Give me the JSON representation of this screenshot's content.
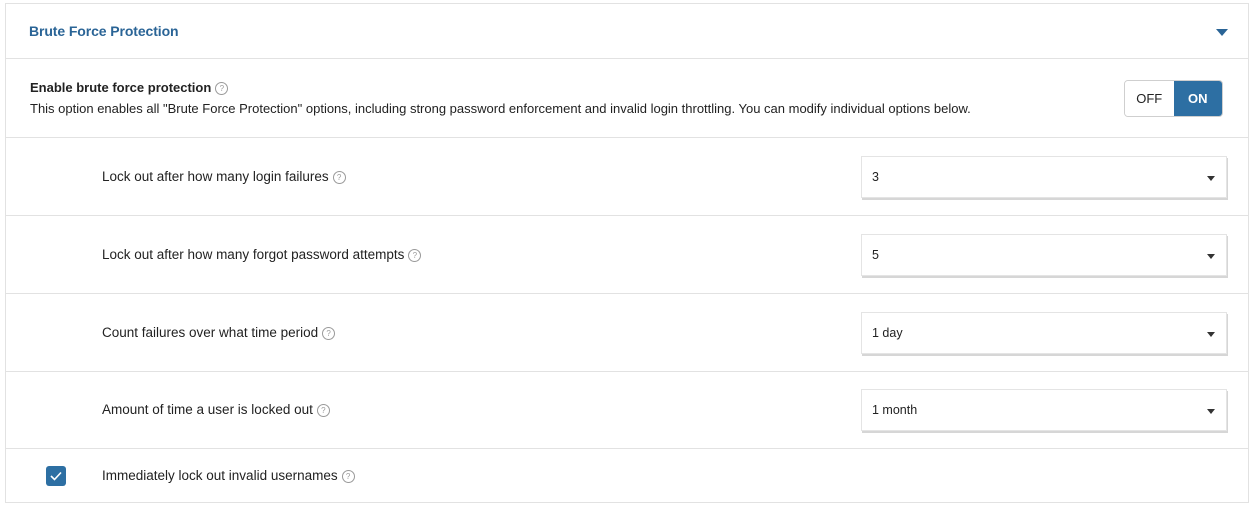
{
  "panel": {
    "title": "Brute Force Protection",
    "collapse_icon": "caret-down-icon"
  },
  "enable": {
    "title": "Enable brute force protection",
    "description": "This option enables all \"Brute Force Protection\" options, including strong password enforcement and invalid login throttling. You can modify individual options below.",
    "help_icon": "help-circle-icon",
    "toggle": {
      "off_label": "OFF",
      "on_label": "ON",
      "state": "ON"
    }
  },
  "settings": [
    {
      "label": "Lock out after how many login failures",
      "value": "3"
    },
    {
      "label": "Lock out after how many forgot password attempts",
      "value": "5"
    },
    {
      "label": "Count failures over what time period",
      "value": "1 day"
    },
    {
      "label": "Amount of time a user is locked out",
      "value": "1 month"
    }
  ],
  "checkbox": {
    "label": "Immediately lock out invalid usernames",
    "checked": true
  },
  "help_glyph": "?",
  "colors": {
    "accent": "#2d6fa3",
    "title": "#2a6496"
  }
}
